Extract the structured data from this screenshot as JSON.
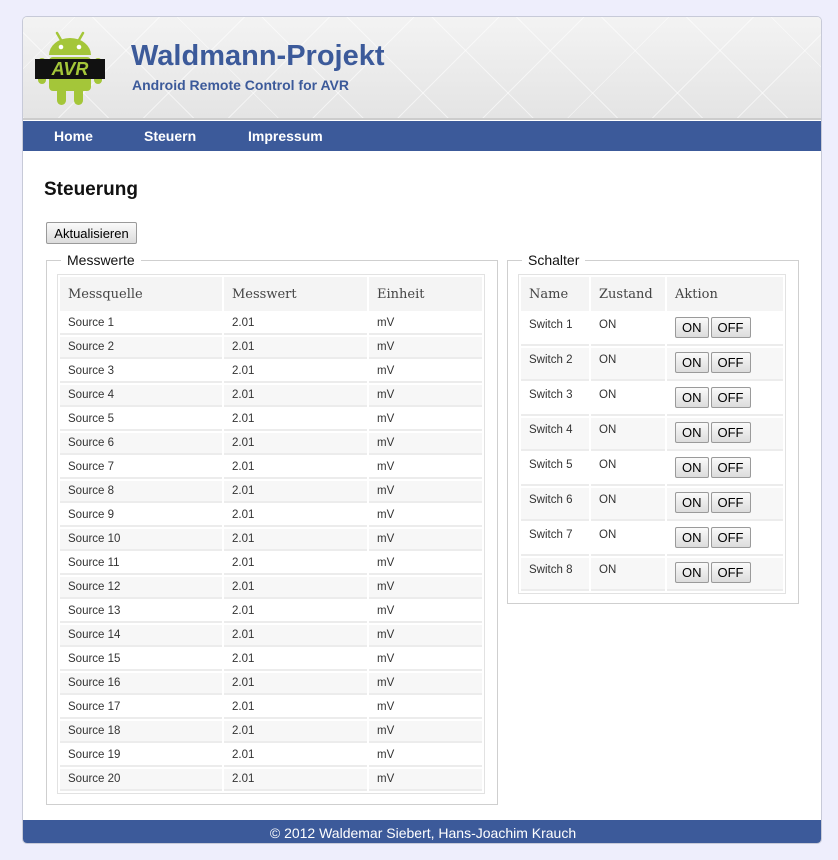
{
  "header": {
    "logo_text": "AVR",
    "title": "Waldmann-Projekt",
    "subtitle": "Android Remote Control for AVR"
  },
  "nav": {
    "items": [
      {
        "label": "Home"
      },
      {
        "label": "Steuern"
      },
      {
        "label": "Impressum"
      }
    ]
  },
  "main": {
    "heading": "Steuerung",
    "refresh_label": "Aktualisieren",
    "measurements": {
      "legend": "Messwerte",
      "columns": [
        "Messquelle",
        "Messwert",
        "Einheit"
      ],
      "rows": [
        [
          "Source 1",
          "2.01",
          "mV"
        ],
        [
          "Source 2",
          "2.01",
          "mV"
        ],
        [
          "Source 3",
          "2.01",
          "mV"
        ],
        [
          "Source 4",
          "2.01",
          "mV"
        ],
        [
          "Source 5",
          "2.01",
          "mV"
        ],
        [
          "Source 6",
          "2.01",
          "mV"
        ],
        [
          "Source 7",
          "2.01",
          "mV"
        ],
        [
          "Source 8",
          "2.01",
          "mV"
        ],
        [
          "Source 9",
          "2.01",
          "mV"
        ],
        [
          "Source 10",
          "2.01",
          "mV"
        ],
        [
          "Source 11",
          "2.01",
          "mV"
        ],
        [
          "Source 12",
          "2.01",
          "mV"
        ],
        [
          "Source 13",
          "2.01",
          "mV"
        ],
        [
          "Source 14",
          "2.01",
          "mV"
        ],
        [
          "Source 15",
          "2.01",
          "mV"
        ],
        [
          "Source 16",
          "2.01",
          "mV"
        ],
        [
          "Source 17",
          "2.01",
          "mV"
        ],
        [
          "Source 18",
          "2.01",
          "mV"
        ],
        [
          "Source 19",
          "2.01",
          "mV"
        ],
        [
          "Source 20",
          "2.01",
          "mV"
        ]
      ]
    },
    "switches": {
      "legend": "Schalter",
      "columns": [
        "Name",
        "Zustand",
        "Aktion"
      ],
      "on_label": "ON",
      "off_label": "OFF",
      "rows": [
        {
          "name": "Switch 1",
          "state": "ON"
        },
        {
          "name": "Switch 2",
          "state": "ON"
        },
        {
          "name": "Switch 3",
          "state": "ON"
        },
        {
          "name": "Switch 4",
          "state": "ON"
        },
        {
          "name": "Switch 5",
          "state": "ON"
        },
        {
          "name": "Switch 6",
          "state": "ON"
        },
        {
          "name": "Switch 7",
          "state": "ON"
        },
        {
          "name": "Switch 8",
          "state": "ON"
        }
      ]
    }
  },
  "footer": {
    "text": "© 2012 Waldemar Siebert, Hans-Joachim Krauch"
  },
  "colors": {
    "brand": "#3c5a9a",
    "android_green": "#a4c639",
    "page_background": "#eeeefc"
  }
}
